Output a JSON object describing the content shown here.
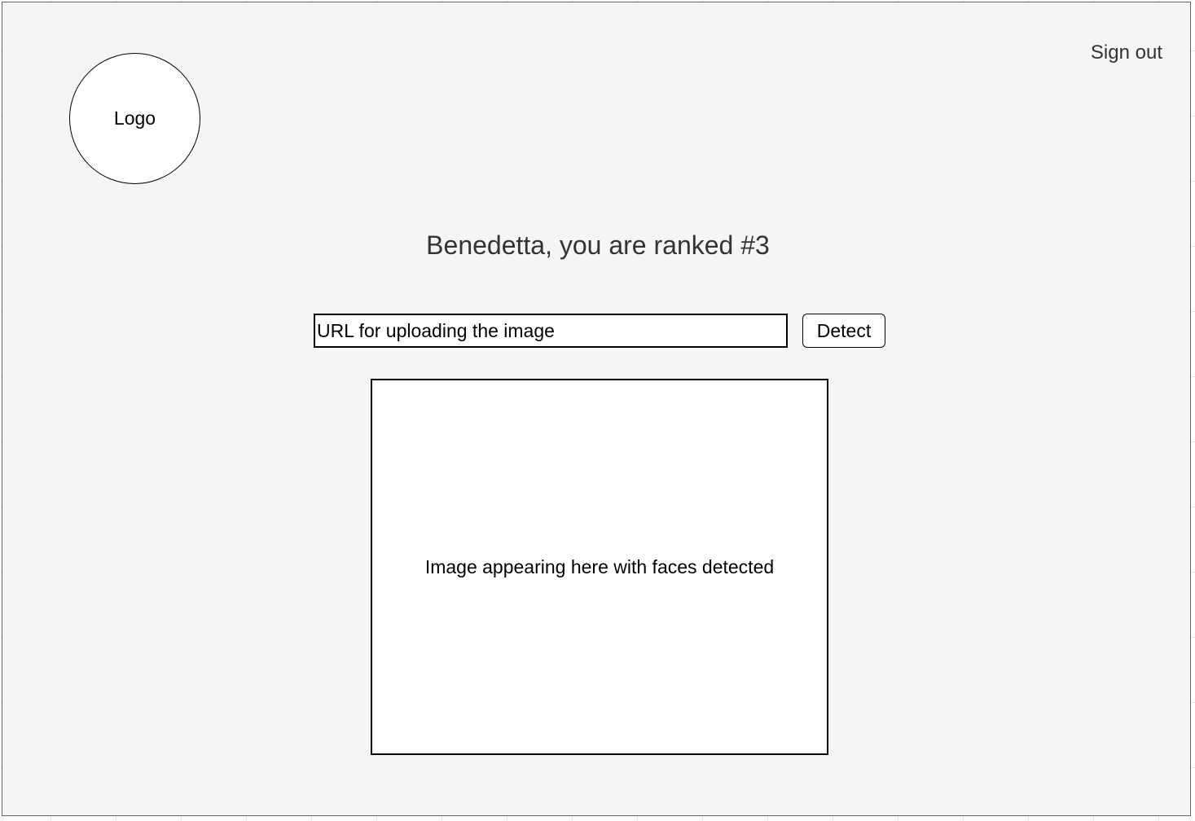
{
  "header": {
    "logo_label": "Logo",
    "signout_label": "Sign out"
  },
  "main": {
    "rank_title": "Benedetta, you are ranked #3",
    "url_input": {
      "placeholder": "URL for uploading the image",
      "value": ""
    },
    "detect_label": "Detect",
    "image_placeholder": "Image appearing here with faces detected"
  }
}
